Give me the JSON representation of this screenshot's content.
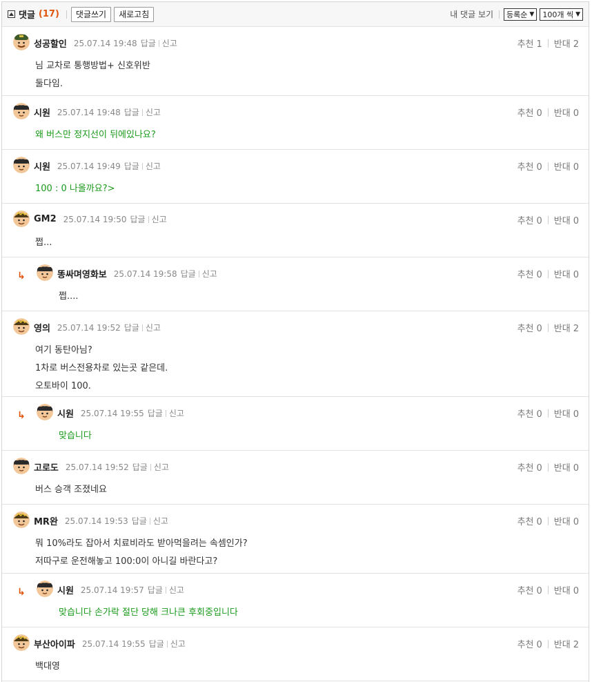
{
  "header": {
    "title": "댓글",
    "count": "(17)",
    "write_button": "댓글쓰기",
    "refresh_button": "새로고침",
    "my_comments_link": "내 댓글 보기",
    "sort_select": "등록순",
    "per_page_select": "100개 씩"
  },
  "labels": {
    "reply": "답글",
    "report": "신고",
    "up": "추천",
    "down": "반대",
    "reply_arrow": "↳"
  },
  "comments": [
    {
      "nick": "성공할인",
      "date": "25.07.14 19:48",
      "up": "1",
      "down": "2",
      "reply": false,
      "green": false,
      "lines": [
        "님 교차로 통행방법+ 신호위반",
        "둘다임."
      ]
    },
    {
      "nick": "시원",
      "date": "25.07.14 19:48",
      "up": "0",
      "down": "0",
      "reply": false,
      "green": true,
      "lines": [
        "왜 버스만 정지선이 뒤에있나요?"
      ]
    },
    {
      "nick": "시원",
      "date": "25.07.14 19:49",
      "up": "0",
      "down": "0",
      "reply": false,
      "green": true,
      "lines": [
        "100 : 0 나올까요?>"
      ]
    },
    {
      "nick": "GM2",
      "date": "25.07.14 19:50",
      "up": "0",
      "down": "0",
      "reply": false,
      "green": false,
      "lines": [
        "쩝..."
      ]
    },
    {
      "nick": "똥싸며영화보",
      "date": "25.07.14 19:58",
      "up": "0",
      "down": "0",
      "reply": true,
      "green": false,
      "lines": [
        "쩝...."
      ]
    },
    {
      "nick": "영의",
      "date": "25.07.14 19:52",
      "up": "0",
      "down": "2",
      "reply": false,
      "green": false,
      "lines": [
        "여기 동탄아님?",
        "1차로 버스전용차로 있는곳 같은데.",
        "오토바이 100."
      ]
    },
    {
      "nick": "시원",
      "date": "25.07.14 19:55",
      "up": "0",
      "down": "0",
      "reply": true,
      "green": true,
      "lines": [
        "맞습니다"
      ]
    },
    {
      "nick": "고로도",
      "date": "25.07.14 19:52",
      "up": "0",
      "down": "0",
      "reply": false,
      "green": false,
      "lines": [
        "버스 승객 조졌네요"
      ]
    },
    {
      "nick": "MR완",
      "date": "25.07.14 19:53",
      "up": "0",
      "down": "0",
      "reply": false,
      "green": false,
      "lines": [
        "뭐 10%라도 잡아서 치료비라도 받아먹을려는 속셈인가?",
        "저따구로 운전해놓고 100:0이 아니길 바란다고?"
      ]
    },
    {
      "nick": "시원",
      "date": "25.07.14 19:57",
      "up": "0",
      "down": "0",
      "reply": true,
      "green": true,
      "lines": [
        "맞습니다 손가락 절단 당해 크나큰 후회중입니다"
      ]
    },
    {
      "nick": "부산아이파",
      "date": "25.07.14 19:55",
      "up": "0",
      "down": "2",
      "reply": false,
      "green": false,
      "lines": [
        "백대영"
      ]
    }
  ],
  "colors": {
    "accent": "#e0550d",
    "green_text": "#1a9a1a",
    "meta_gray": "#888888"
  }
}
